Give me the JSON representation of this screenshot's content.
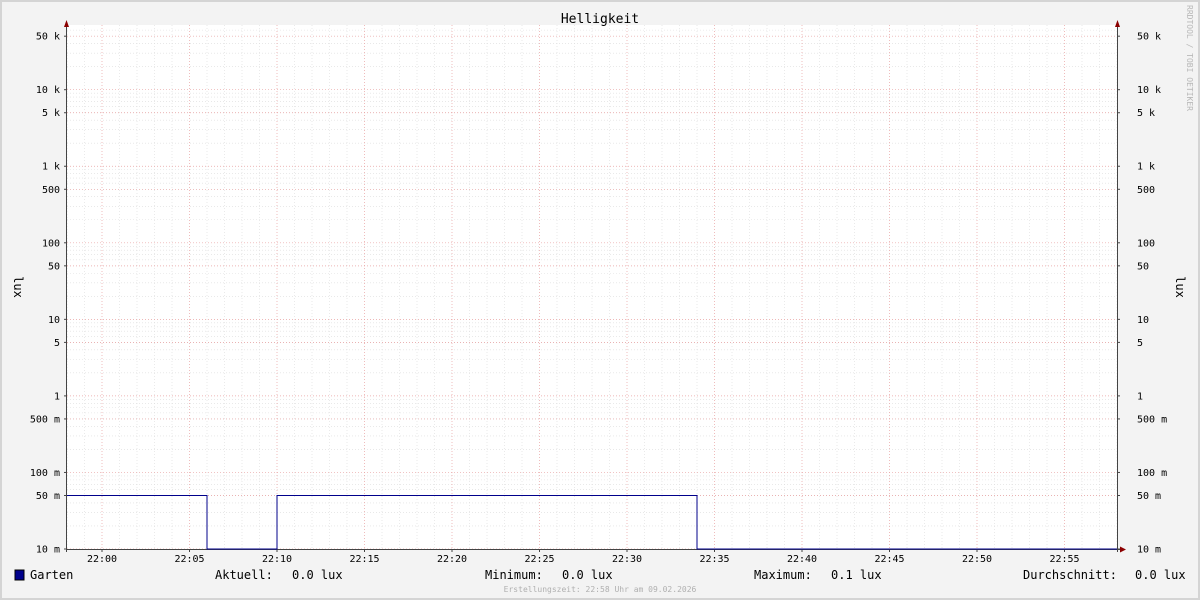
{
  "chart_data": {
    "type": "line",
    "title": "Helligkeit",
    "ylabel": "lux",
    "ylabel_right": "lux",
    "y_scale": "log",
    "ylim": [
      0.01,
      70000
    ],
    "xlim": [
      "21:58",
      "22:58"
    ],
    "x_ticks": [
      "22:00",
      "22:05",
      "22:10",
      "22:15",
      "22:20",
      "22:25",
      "22:30",
      "22:35",
      "22:40",
      "22:45",
      "22:50",
      "22:55"
    ],
    "y_ticks": [
      {
        "value": 0.01,
        "label": "10 m"
      },
      {
        "value": 0.05,
        "label": "50 m"
      },
      {
        "value": 0.1,
        "label": "100 m"
      },
      {
        "value": 0.5,
        "label": "500 m"
      },
      {
        "value": 1,
        "label": "1"
      },
      {
        "value": 5,
        "label": "5"
      },
      {
        "value": 10,
        "label": "10"
      },
      {
        "value": 50,
        "label": "50"
      },
      {
        "value": 100,
        "label": "100"
      },
      {
        "value": 500,
        "label": "500"
      },
      {
        "value": 1000,
        "label": "1 k"
      },
      {
        "value": 5000,
        "label": "5 k"
      },
      {
        "value": 10000,
        "label": "10 k"
      },
      {
        "value": 50000,
        "label": "50 k"
      }
    ],
    "grid": true,
    "series": [
      {
        "name": "Garten",
        "color": "#00008b",
        "step": true,
        "points": [
          {
            "x": "21:58",
            "y": 0.05
          },
          {
            "x": "22:06",
            "y": 0.01
          },
          {
            "x": "22:10",
            "y": 0.05
          },
          {
            "x": "22:34",
            "y": 0.01
          },
          {
            "x": "22:58",
            "y": 0.01
          }
        ]
      }
    ],
    "legend": {
      "position": "bottom-left",
      "stats": [
        {
          "label": "Aktuell:",
          "value": "0.0 lux"
        },
        {
          "label": "Minimum:",
          "value": "0.0 lux"
        },
        {
          "label": "Maximum:",
          "value": "0.1 lux"
        },
        {
          "label": "Durchschnitt:",
          "value": "0.0 lux"
        }
      ]
    },
    "footer": "Erstellungszeit: 22:58 Uhr am 09.02.2026",
    "watermark": "RRDTOOL / TOBI OETIKER"
  }
}
